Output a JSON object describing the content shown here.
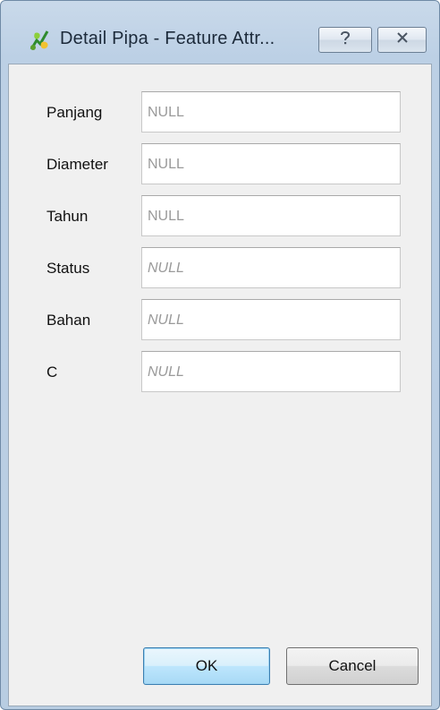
{
  "window": {
    "title": "Detail Pipa - Feature Attr...",
    "app_icon": "qgis-icon",
    "help_icon": "help-icon",
    "close_icon": "close-icon"
  },
  "fields": [
    {
      "label": "Panjang",
      "value": "NULL",
      "italic": false
    },
    {
      "label": "Diameter",
      "value": "NULL",
      "italic": false
    },
    {
      "label": "Tahun",
      "value": "NULL",
      "italic": false
    },
    {
      "label": "Status",
      "value": "NULL",
      "italic": true
    },
    {
      "label": "Bahan",
      "value": "NULL",
      "italic": true
    },
    {
      "label": "C",
      "value": "NULL",
      "italic": true
    }
  ],
  "buttons": {
    "ok_label": "OK",
    "cancel_label": "Cancel"
  },
  "colors": {
    "frame": "#bcd0e5",
    "client_bg": "#f0f0f0",
    "default_button": "#bee6fd",
    "null_text": "#9a9a9a"
  }
}
